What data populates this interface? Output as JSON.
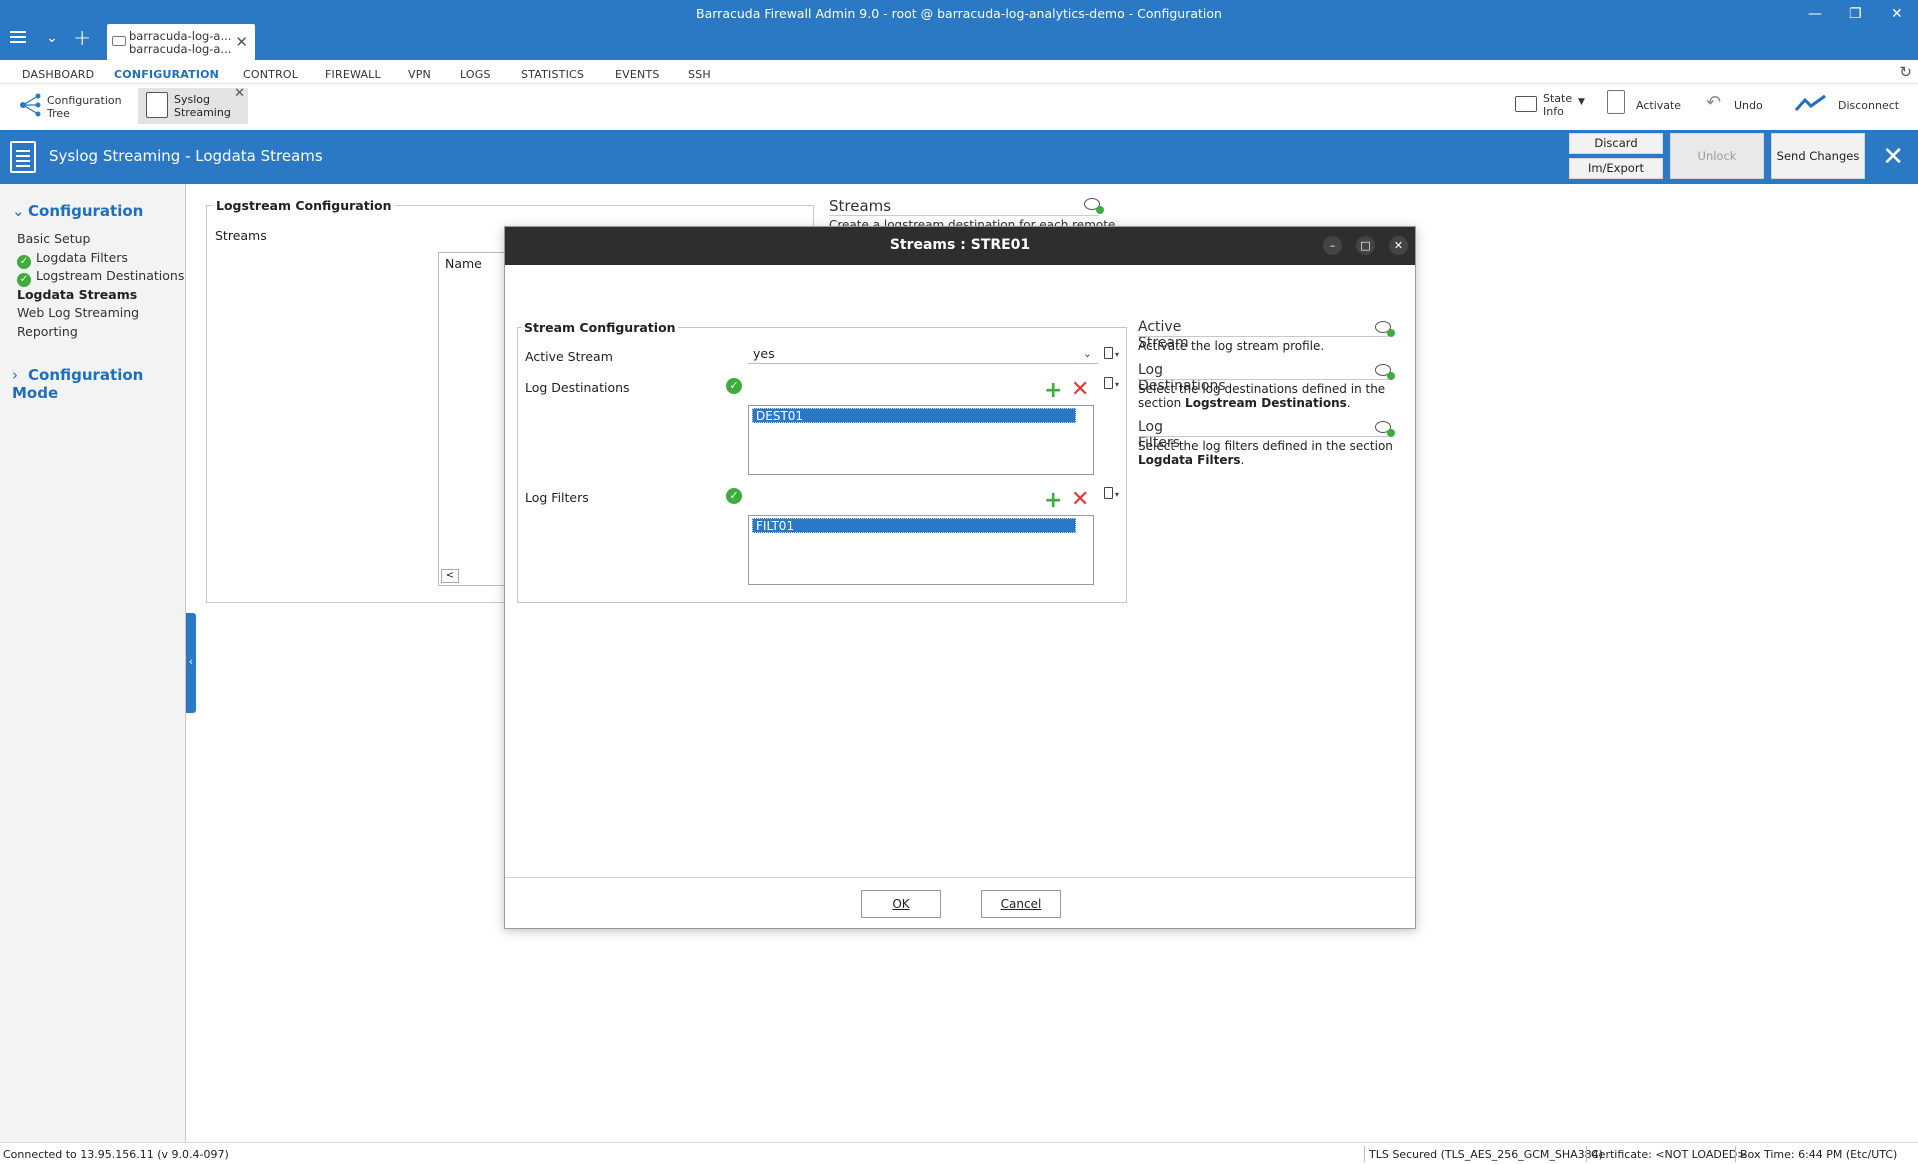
{
  "window": {
    "title": "Barracuda Firewall Admin 9.0 -  root @ barracuda-log-analytics-demo  - Configuration",
    "tab_line1": "barracuda-log-a...",
    "tab_line2": "barracuda-log-a..."
  },
  "menu": [
    "DASHBOARD",
    "CONFIGURATION",
    "CONTROL",
    "FIREWALL",
    "VPN",
    "LOGS",
    "STATISTICS",
    "EVENTS",
    "SSH"
  ],
  "menu_active": "CONFIGURATION",
  "toolbar": {
    "config_tree": "Configuration Tree",
    "config_tree_l1": "Configuration",
    "config_tree_l2": "Tree",
    "syslog_l1": "Syslog",
    "syslog_l2": "Streaming",
    "state_l1": "State",
    "state_l2": "Info",
    "activate": "Activate",
    "undo": "Undo",
    "disconnect": "Disconnect"
  },
  "page_header": {
    "title": "Syslog Streaming - Logdata Streams",
    "discard": "Discard",
    "im_export": "Im/Export",
    "unlock": "Unlock",
    "send_changes": "Send Changes"
  },
  "sidebar": {
    "section1": "Configuration",
    "items": [
      {
        "label": "Basic Setup",
        "check": false,
        "bold": false
      },
      {
        "label": "Logdata Filters",
        "check": true,
        "bold": false
      },
      {
        "label": "Logstream Destinations",
        "check": true,
        "bold": false
      },
      {
        "label": "Logdata Streams",
        "check": false,
        "bold": true
      },
      {
        "label": "Web Log Streaming",
        "check": false,
        "bold": false
      },
      {
        "label": "Reporting",
        "check": false,
        "bold": false
      }
    ],
    "section2": "Configuration Mode"
  },
  "background": {
    "fieldset_legend": "Logstream Configuration",
    "streams_label": "Streams",
    "table_header": "Name",
    "help_title": "Streams",
    "help_text": "Create a logstream destination for each remote"
  },
  "dialog": {
    "title": "Streams : STRE01",
    "fieldset_legend": "Stream Configuration",
    "active_stream_label": "Active Stream",
    "active_stream_value": "yes",
    "log_destinations_label": "Log Destinations",
    "log_destinations_items": [
      "DEST01"
    ],
    "log_filters_label": "Log Filters",
    "log_filters_items": [
      "FILT01"
    ],
    "ok": "OK",
    "cancel": "Cancel",
    "help": {
      "active_stream_title": "Active Stream",
      "active_stream_text": "Activate the log stream profile.",
      "log_destinations_title": "Log Destinations",
      "log_destinations_text_pre": "Select the log destinations defined in the section ",
      "log_destinations_text_bold": "Logstream Destinations",
      "log_filters_title": "Log Filters",
      "log_filters_text_pre": "Select the log filters defined in the section ",
      "log_filters_text_bold": "Logdata Filters"
    }
  },
  "statusbar": {
    "connected": "Connected to 13.95.156.11 (v 9.0.4-097)",
    "tls": "TLS Secured (TLS_AES_256_GCM_SHA384)",
    "certificate": "Certificate: <NOT LOADED>",
    "box_time": "Box Time: 6:44 PM (Etc/UTC)"
  },
  "colors": {
    "brand_blue": "#2b78c5",
    "dialog_titlebar": "#2e2e2e",
    "check_green": "#3dae3d",
    "delete_red": "#e23a32"
  }
}
